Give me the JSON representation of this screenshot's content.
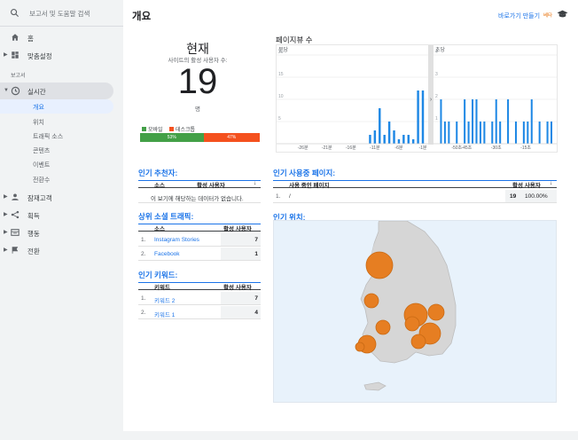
{
  "sidebar": {
    "search_placeholder": "보고서 및 도움말 검색",
    "home": "홈",
    "customization": "맞춤설정",
    "section_label": "보고서",
    "realtime": "실시간",
    "realtime_sub": [
      "개요",
      "위치",
      "트래픽 소스",
      "콘텐츠",
      "이벤트",
      "전환수"
    ],
    "audience": "잠재고객",
    "acquisition": "획득",
    "behavior": "행동",
    "conversions": "전환"
  },
  "header": {
    "title": "개요",
    "shortcut_label": "바로가기 만들기",
    "beta": "베타"
  },
  "current": {
    "title": "현재",
    "subtitle": "사이트의 활성 사용자 수:",
    "count": "19",
    "unit": "명",
    "mobile_label": "모바일",
    "desktop_label": "데스크톱",
    "mobile_pct": "53%",
    "desktop_pct": "47%",
    "mobile_share": 0.53,
    "desktop_share": 0.47,
    "mobile_color": "#43a047",
    "desktop_color": "#f4511e"
  },
  "pageviews": {
    "title": "페이지뷰 수"
  },
  "chart_data": {
    "type": "bar",
    "title": "페이지뷰 수",
    "left_panel": {
      "xlabel": "분당",
      "ylim": [
        0,
        20
      ],
      "yticks": [
        "20",
        "15",
        "10",
        "5"
      ],
      "xticks": [
        "-26분",
        "-21분",
        "-16분",
        "-11분",
        "-6분",
        "-1분"
      ],
      "x": [
        -30,
        -29,
        -28,
        -27,
        -26,
        -25,
        -24,
        -23,
        -22,
        -21,
        -20,
        -19,
        -18,
        -17,
        -16,
        -15,
        -14,
        -13,
        -12,
        -11,
        -10,
        -9,
        -8,
        -7,
        -6,
        -5,
        -4,
        -3,
        -2,
        -1
      ],
      "values": [
        0,
        0,
        0,
        0,
        0,
        0,
        0,
        0,
        0,
        0,
        0,
        0,
        0,
        0,
        0,
        0,
        0,
        0,
        2,
        3,
        8,
        2,
        5,
        3,
        1,
        2,
        2,
        1,
        12,
        12
      ]
    },
    "right_panel": {
      "xlabel": "초당",
      "ylim": [
        0,
        4
      ],
      "yticks": [
        "4",
        "3",
        "2",
        "1"
      ],
      "xticks": [
        "-50초",
        "-45초",
        "-30초",
        "-15초"
      ],
      "x": [
        -60,
        -58,
        -56,
        -54,
        -52,
        -50,
        -48,
        -46,
        -44,
        -42,
        -40,
        -38,
        -36,
        -34,
        -32,
        -30,
        -28,
        -26,
        -24,
        -22,
        -20,
        -18,
        -16,
        -14,
        -12,
        -10,
        -8,
        -6,
        -4,
        -2
      ],
      "values": [
        0,
        2,
        1,
        1,
        0,
        1,
        0,
        2,
        1,
        2,
        2,
        1,
        1,
        0,
        1,
        2,
        1,
        0,
        2,
        0,
        1,
        0,
        1,
        1,
        2,
        0,
        1,
        0,
        1,
        1
      ]
    },
    "grid": true
  },
  "referrers": {
    "title": "인기 추천자:",
    "col_source": "소스",
    "col_active": "활성 사용자",
    "empty": "이 보기에 해당하는 데이터가 없습니다."
  },
  "social": {
    "title": "상위 소셜 트래픽:",
    "col_source": "소스",
    "col_active": "활성 사용자",
    "rows": [
      {
        "num": "1.",
        "name": "Instagram Stories",
        "value": "7"
      },
      {
        "num": "2.",
        "name": "Facebook",
        "value": "1"
      }
    ]
  },
  "keywords": {
    "title": "인기 키워드:",
    "col_keyword": "키워드",
    "col_active": "활성 사용자",
    "rows": [
      {
        "num": "1.",
        "name": "키워드 2",
        "value": "7"
      },
      {
        "num": "2.",
        "name": "키워드 1",
        "value": "4"
      }
    ]
  },
  "active_pages": {
    "title": "인기 사용중 페이지:",
    "col_page": "사용 중인 페이지",
    "col_active": "활성 사용자",
    "rows": [
      {
        "num": "1.",
        "name": "/",
        "value": "19",
        "pct": "100.00%"
      }
    ]
  },
  "locations": {
    "title": "인기 위치:",
    "bubble_color": "#e67e22"
  }
}
